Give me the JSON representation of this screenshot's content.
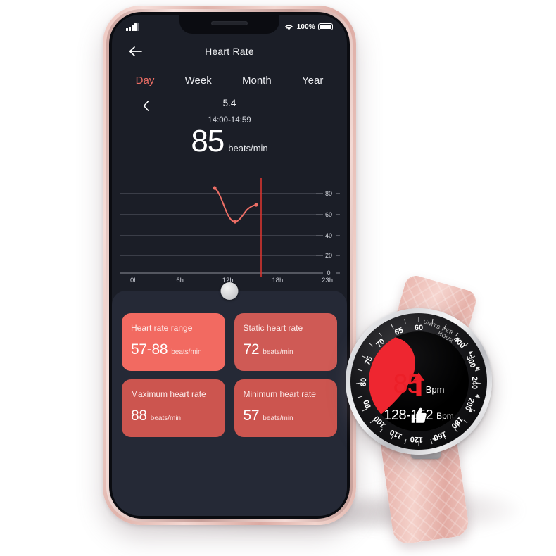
{
  "phone": {
    "status_bar": {
      "signal_icon": "cellular-signal-icon",
      "wifi_icon": "wifi-icon",
      "battery_percent": "100%",
      "battery_icon": "battery-full-icon"
    },
    "nav": {
      "back_icon": "back-arrow-icon",
      "title": "Heart Rate"
    },
    "tabs": [
      {
        "label": "Day",
        "active": true
      },
      {
        "label": "Week",
        "active": false
      },
      {
        "label": "Month",
        "active": false
      },
      {
        "label": "Year",
        "active": false
      }
    ],
    "date_nav": {
      "prev_icon": "chevron-left-icon",
      "date": "5.4"
    },
    "reading": {
      "time_range": "14:00-14:59",
      "value": "85",
      "unit": "beats/min"
    },
    "cards": [
      {
        "title": "Heart rate range",
        "value": "57-88",
        "unit": "beats/min",
        "color": "#f26a61"
      },
      {
        "title": "Static heart rate",
        "value": "72",
        "unit": "beats/min",
        "color": "#cf5a55"
      },
      {
        "title": "Maximum heart rate",
        "value": "88",
        "unit": "beats/min",
        "color": "#cc554f"
      },
      {
        "title": "Minimum heart rate",
        "value": "57",
        "unit": "beats/min",
        "color": "#cc554f"
      }
    ],
    "scrubber_handle": "chart-scrubber-handle"
  },
  "chart_data": {
    "type": "line",
    "title": "Heart Rate",
    "xlabel": "",
    "ylabel": "beats/min",
    "x_ticks": [
      "0h",
      "6h",
      "12h",
      "18h",
      "23h"
    ],
    "y_ticks": [
      "0",
      "20",
      "40",
      "60",
      "80"
    ],
    "ylim": [
      0,
      90
    ],
    "xlim": [
      0,
      23
    ],
    "grid": true,
    "legend": "none",
    "line_color": "#ef6f66",
    "marker_points": [
      {
        "x": 10.0,
        "y": 88
      },
      {
        "x": 12.0,
        "y": 57
      },
      {
        "x": 13.6,
        "y": 72
      }
    ],
    "series": [
      {
        "name": "Heart rate",
        "x": [
          10.0,
          10.6,
          11.2,
          11.6,
          12.0,
          12.5,
          13.0,
          13.6
        ],
        "values": [
          88,
          84,
          73,
          62,
          57,
          60,
          67,
          72
        ]
      }
    ],
    "cursor": {
      "x": 14.0,
      "label": "14:00-14:59",
      "value": 85,
      "color": "#d8342f"
    }
  },
  "watch": {
    "bezel_text_1": "UNITS PER",
    "bezel_text_2": "HOUR",
    "bezel_numbers": [
      "60",
      "65",
      "70",
      "75",
      "80",
      "90",
      "100",
      "110",
      "120",
      "160",
      "180",
      "200",
      "240",
      "300",
      "400"
    ],
    "face": {
      "heart_icon": "heart-icon",
      "trend_icon": "up-arrow-icon",
      "bpm_value": "85",
      "bpm_unit": "Bpm",
      "thumb_icon": "thumbs-up-icon",
      "range_value": "128-152",
      "range_unit": "Bpm"
    },
    "crown": "watch-crown-button"
  }
}
